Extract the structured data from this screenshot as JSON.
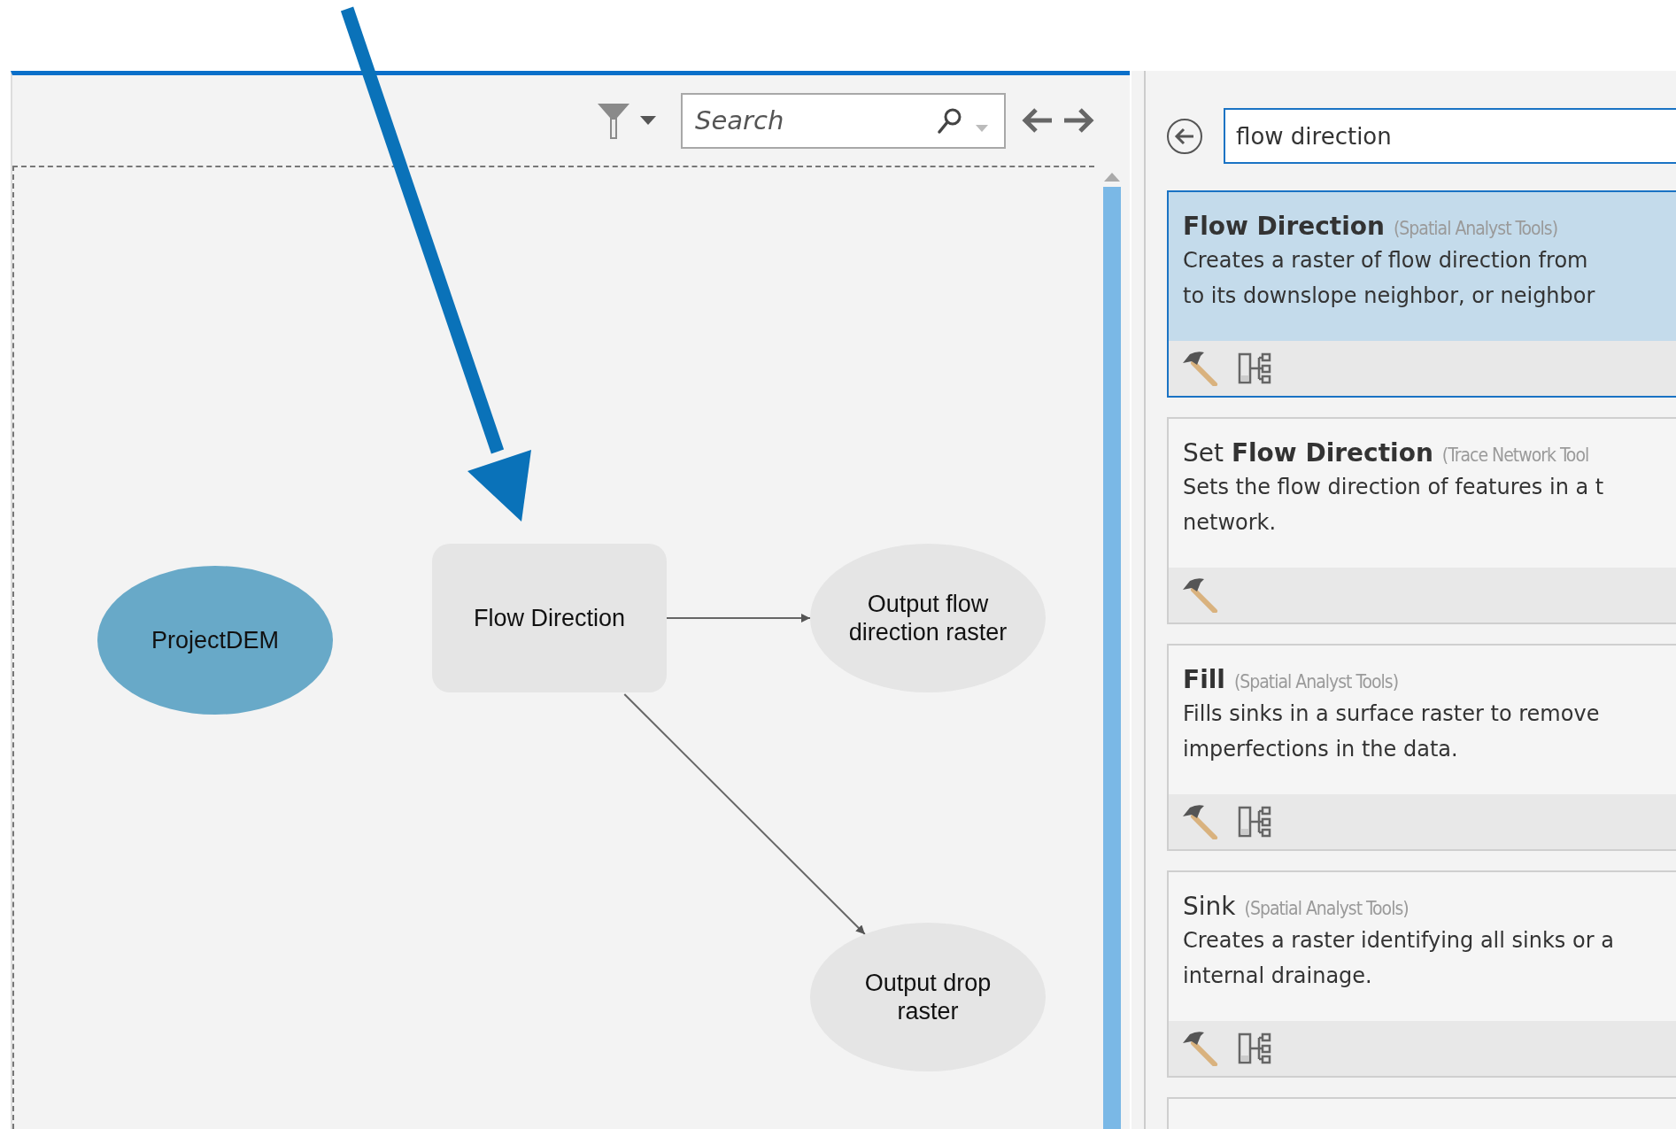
{
  "model_builder": {
    "toolbar": {
      "search": {
        "placeholder": "Search"
      }
    },
    "nodes": [
      {
        "kind": "input",
        "label": "ProjectDEM"
      },
      {
        "kind": "tool",
        "label": "Flow Direction"
      },
      {
        "kind": "output",
        "label": "Output flow\ndirection raster"
      },
      {
        "kind": "output",
        "label": "Output drop\nraster"
      }
    ]
  },
  "geoprocessing": {
    "search": {
      "value": "flow direction"
    },
    "results": [
      {
        "title": "Flow Direction",
        "category": "(Spatial Analyst Tools)",
        "description": "Creates a raster of flow direction from\nto its downslope neighbor, or neighbor",
        "model_icon": true,
        "title_bold": true,
        "selected": true
      },
      {
        "title": "Set **Flow Direction**",
        "category": "(Trace Network Tool",
        "description": "Sets the flow direction of features in a t\nnetwork.",
        "model_icon": false,
        "title_bold": false,
        "selected": false
      },
      {
        "title": "Fill",
        "category": "(Spatial Analyst Tools)",
        "description": "Fills sinks in a surface raster to remove\nimperfections in the data.",
        "model_icon": true,
        "title_bold": true,
        "selected": false
      },
      {
        "title": "Sink",
        "category": "(Spatial Analyst Tools)",
        "description": "Creates a raster identifying all sinks or a\ninternal drainage.",
        "model_icon": true,
        "title_bold": false,
        "selected": false
      }
    ]
  }
}
